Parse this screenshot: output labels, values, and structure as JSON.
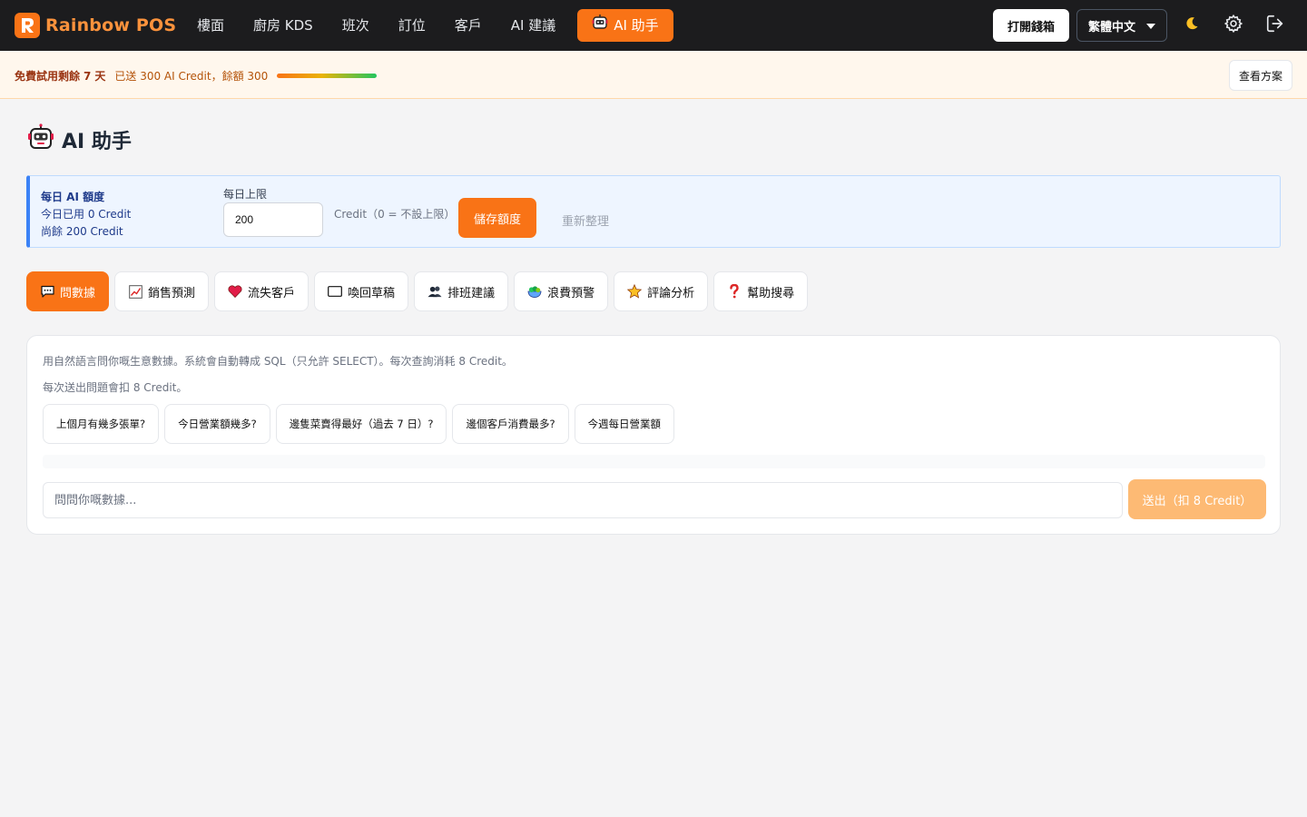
{
  "app": {
    "brand": "Rainbow POS",
    "accent": "#f97316"
  },
  "nav": {
    "items": [
      {
        "label": "樓面",
        "active": false
      },
      {
        "label": "廚房 KDS",
        "active": false
      },
      {
        "label": "班次",
        "active": false
      },
      {
        "label": "訂位",
        "active": false
      },
      {
        "label": "客戶",
        "active": false
      },
      {
        "label": "AI 建議",
        "active": false
      },
      {
        "label": "AI 助手",
        "active": true,
        "icon": "robot-icon"
      }
    ],
    "open_drawer": "打開錢箱",
    "language": "繁體中文",
    "icons": [
      "moon-icon",
      "gear-icon",
      "logout-icon"
    ]
  },
  "banner": {
    "trial_prefix": "免費試用剩餘",
    "trial_days": "7",
    "trial_suffix": "天",
    "credit_text": "已送 300 AI Credit，餘額 300",
    "credit_remaining_fraction": 1.0,
    "plan_button": "查看方案"
  },
  "page": {
    "title": "AI 助手",
    "title_icon": "robot-icon"
  },
  "quota": {
    "title": "每日 AI 額度",
    "used": "今日已用 0 Credit",
    "remaining": "尚餘 200 Credit",
    "limit_label": "每日上限",
    "limit_value": "200",
    "limit_hint": "Credit（0 = 不設上限）",
    "save_button": "儲存額度",
    "refresh_button": "重新整理"
  },
  "tabs": [
    {
      "label": "問數據",
      "icon": "speech-bubble-icon",
      "active": true
    },
    {
      "label": "銷售預測",
      "icon": "chart-trend-icon",
      "active": false
    },
    {
      "label": "流失客戶",
      "icon": "heart-icon",
      "active": false
    },
    {
      "label": "喚回草稿",
      "icon": "envelope-icon",
      "active": false
    },
    {
      "label": "排班建議",
      "icon": "people-icon",
      "active": false
    },
    {
      "label": "浪費預警",
      "icon": "salad-icon",
      "active": false
    },
    {
      "label": "評論分析",
      "icon": "star-icon",
      "active": false
    },
    {
      "label": "幫助搜尋",
      "icon": "question-icon",
      "active": false
    }
  ],
  "query": {
    "description": "用自然語言問你嘅生意數據。系統會自動轉成 SQL（只允許 SELECT）。每次查詢消耗 8 Credit。",
    "cost_note": "每次送出問題會扣 8 Credit。",
    "suggestions": [
      "上個月有幾多張單?",
      "今日營業額幾多?",
      "邊隻菜賣得最好（過去 7 日）?",
      "邊個客戶消費最多?",
      "今週每日營業額"
    ],
    "input_placeholder": "問問你嘅數據...",
    "send_button": "送出（扣 8 Credit）"
  }
}
